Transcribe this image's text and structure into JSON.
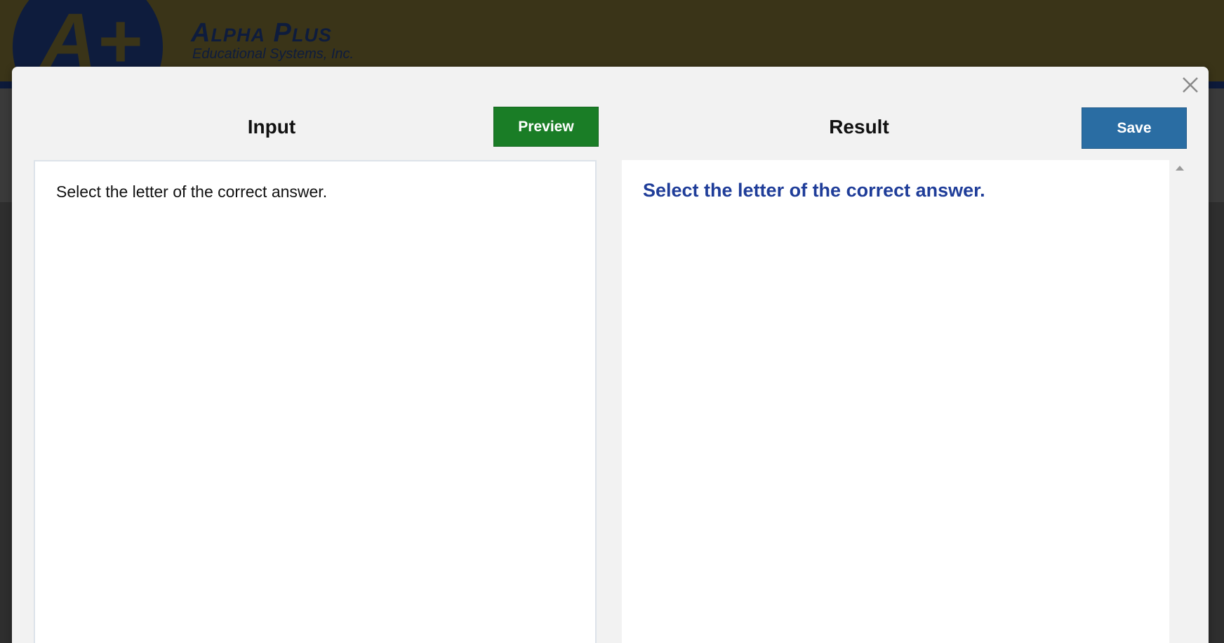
{
  "background": {
    "brand": {
      "logo_glyph": "A+",
      "name": "Alpha Plus",
      "tagline": "Educational Systems, Inc."
    }
  },
  "modal": {
    "input": {
      "title": "Input",
      "text": "Select the letter of the correct answer."
    },
    "result": {
      "title": "Result",
      "text": "Select the letter of the correct answer."
    },
    "buttons": {
      "preview_label": "Preview",
      "save_label": "Save"
    },
    "icons": {
      "close": "close-icon",
      "scroll_up": "scroll-up-arrow-icon"
    }
  },
  "colors": {
    "preview_button": "#1a7d26",
    "save_button": "#2a6da3",
    "result_text": "#1f3d99"
  }
}
